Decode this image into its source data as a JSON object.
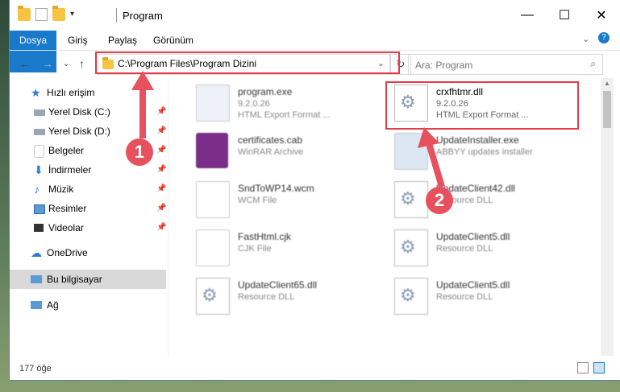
{
  "window": {
    "title": "Program",
    "controls": {
      "minimize": "—",
      "maximize": "☐",
      "close": "✕"
    }
  },
  "ribbon": {
    "tabs": [
      "Dosya",
      "Giriş",
      "Paylaş",
      "Görünüm"
    ]
  },
  "nav": {
    "address": "C:\\Program Files\\Program Dizini",
    "search_placeholder": "Ara: Program",
    "refresh": "↻",
    "back": "←",
    "forward": "→",
    "up": "↑"
  },
  "sidebar": {
    "items": [
      {
        "label": "Hızlı erişim"
      },
      {
        "label": "Yerel Disk (C:)"
      },
      {
        "label": "Yerel Disk (D:)"
      },
      {
        "label": "Belgeler"
      },
      {
        "label": "İndirmeler"
      },
      {
        "label": "Müzik"
      },
      {
        "label": "Resimler"
      },
      {
        "label": "Videolar"
      },
      {
        "label": "OneDrive"
      },
      {
        "label": "Bu bilgisayar"
      },
      {
        "label": "Ağ"
      }
    ]
  },
  "files": [
    {
      "name": "program.exe",
      "line1": "9.2.0.26",
      "line2": "HTML Export Format ..."
    },
    {
      "name": "crxfhtmr.dll",
      "line1": "9.2.0.26",
      "line2": "HTML Export Format ..."
    },
    {
      "name": "certificates.cab",
      "line1": "WinRAR Archive",
      "line2": ""
    },
    {
      "name": "UpdateInstaller.exe",
      "line1": "ABBYY updates installer",
      "line2": ""
    },
    {
      "name": "SndToWP14.wcm",
      "line1": "WCM File",
      "line2": ""
    },
    {
      "name": "UpdateClient42.dll",
      "line1": "Resource DLL",
      "line2": ""
    },
    {
      "name": "FastHtml.cjk",
      "line1": "CJK File",
      "line2": ""
    },
    {
      "name": "UpdateClient5.dll",
      "line1": "Resource DLL",
      "line2": ""
    },
    {
      "name": "UpdateClient65.dll",
      "line1": "Resource DLL",
      "line2": ""
    },
    {
      "name": "UpdateClient5.dll",
      "line1": "Resource DLL",
      "line2": ""
    }
  ],
  "status": {
    "count": "177 öğe"
  },
  "annotations": {
    "marker1": "1",
    "marker2": "2",
    "highlight_color": "#e43a4a"
  }
}
